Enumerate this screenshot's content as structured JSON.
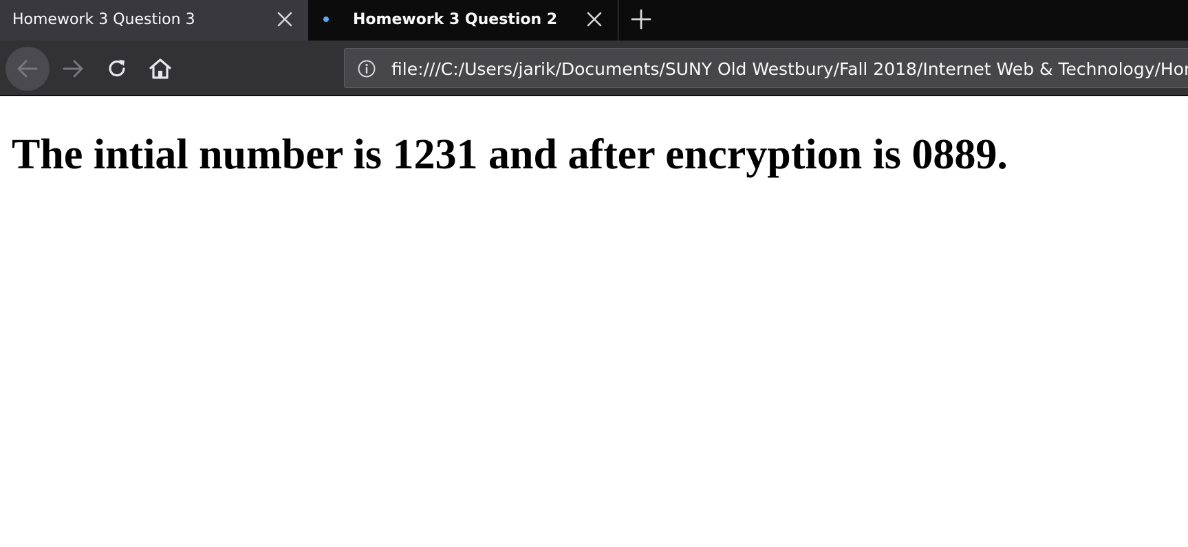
{
  "tabs": [
    {
      "title": "Homework 3 Question 3",
      "active": false
    },
    {
      "title": "Homework 3 Question 2",
      "active": true
    }
  ],
  "navbar": {
    "back_icon": "arrow-left-icon",
    "forward_icon": "arrow-right-icon",
    "reload_icon": "reload-icon",
    "home_icon": "home-icon",
    "info_icon": "info-icon",
    "url": "file:///C:/Users/jarik/Documents/SUNY Old Westbury/Fall 2018/Internet Web & Technology/Hor"
  },
  "page": {
    "heading": "The intial number is 1231 and after encryption is 0889."
  },
  "colors": {
    "tabstrip_bg": "#0c0c0d",
    "inactive_tab_bg": "#38383d",
    "navbar_bg": "#323234",
    "urlbar_bg": "#474749",
    "tab_dot": "#5aa7f5",
    "page_bg": "#ffffff",
    "text_on_dark": "#f9f9fa"
  }
}
